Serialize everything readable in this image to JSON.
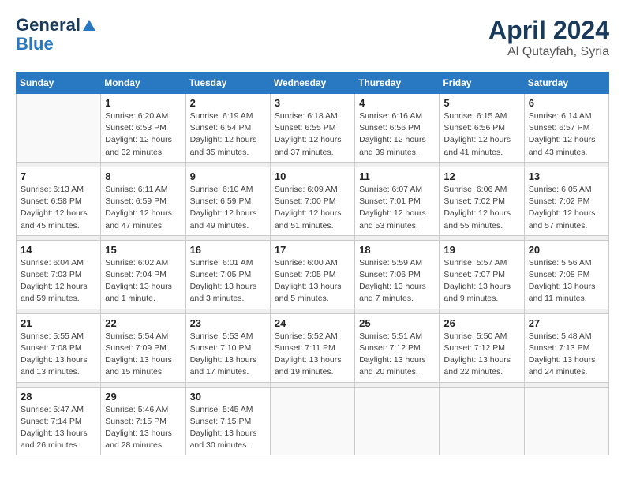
{
  "header": {
    "logo_line1": "General",
    "logo_line2": "Blue",
    "title": "April 2024",
    "location": "Al Qutayfah, Syria"
  },
  "days_of_week": [
    "Sunday",
    "Monday",
    "Tuesday",
    "Wednesday",
    "Thursday",
    "Friday",
    "Saturday"
  ],
  "weeks": [
    {
      "days": [
        {
          "num": "",
          "detail": ""
        },
        {
          "num": "1",
          "detail": "Sunrise: 6:20 AM\nSunset: 6:53 PM\nDaylight: 12 hours\nand 32 minutes."
        },
        {
          "num": "2",
          "detail": "Sunrise: 6:19 AM\nSunset: 6:54 PM\nDaylight: 12 hours\nand 35 minutes."
        },
        {
          "num": "3",
          "detail": "Sunrise: 6:18 AM\nSunset: 6:55 PM\nDaylight: 12 hours\nand 37 minutes."
        },
        {
          "num": "4",
          "detail": "Sunrise: 6:16 AM\nSunset: 6:56 PM\nDaylight: 12 hours\nand 39 minutes."
        },
        {
          "num": "5",
          "detail": "Sunrise: 6:15 AM\nSunset: 6:56 PM\nDaylight: 12 hours\nand 41 minutes."
        },
        {
          "num": "6",
          "detail": "Sunrise: 6:14 AM\nSunset: 6:57 PM\nDaylight: 12 hours\nand 43 minutes."
        }
      ]
    },
    {
      "days": [
        {
          "num": "7",
          "detail": "Sunrise: 6:13 AM\nSunset: 6:58 PM\nDaylight: 12 hours\nand 45 minutes."
        },
        {
          "num": "8",
          "detail": "Sunrise: 6:11 AM\nSunset: 6:59 PM\nDaylight: 12 hours\nand 47 minutes."
        },
        {
          "num": "9",
          "detail": "Sunrise: 6:10 AM\nSunset: 6:59 PM\nDaylight: 12 hours\nand 49 minutes."
        },
        {
          "num": "10",
          "detail": "Sunrise: 6:09 AM\nSunset: 7:00 PM\nDaylight: 12 hours\nand 51 minutes."
        },
        {
          "num": "11",
          "detail": "Sunrise: 6:07 AM\nSunset: 7:01 PM\nDaylight: 12 hours\nand 53 minutes."
        },
        {
          "num": "12",
          "detail": "Sunrise: 6:06 AM\nSunset: 7:02 PM\nDaylight: 12 hours\nand 55 minutes."
        },
        {
          "num": "13",
          "detail": "Sunrise: 6:05 AM\nSunset: 7:02 PM\nDaylight: 12 hours\nand 57 minutes."
        }
      ]
    },
    {
      "days": [
        {
          "num": "14",
          "detail": "Sunrise: 6:04 AM\nSunset: 7:03 PM\nDaylight: 12 hours\nand 59 minutes."
        },
        {
          "num": "15",
          "detail": "Sunrise: 6:02 AM\nSunset: 7:04 PM\nDaylight: 13 hours\nand 1 minute."
        },
        {
          "num": "16",
          "detail": "Sunrise: 6:01 AM\nSunset: 7:05 PM\nDaylight: 13 hours\nand 3 minutes."
        },
        {
          "num": "17",
          "detail": "Sunrise: 6:00 AM\nSunset: 7:05 PM\nDaylight: 13 hours\nand 5 minutes."
        },
        {
          "num": "18",
          "detail": "Sunrise: 5:59 AM\nSunset: 7:06 PM\nDaylight: 13 hours\nand 7 minutes."
        },
        {
          "num": "19",
          "detail": "Sunrise: 5:57 AM\nSunset: 7:07 PM\nDaylight: 13 hours\nand 9 minutes."
        },
        {
          "num": "20",
          "detail": "Sunrise: 5:56 AM\nSunset: 7:08 PM\nDaylight: 13 hours\nand 11 minutes."
        }
      ]
    },
    {
      "days": [
        {
          "num": "21",
          "detail": "Sunrise: 5:55 AM\nSunset: 7:08 PM\nDaylight: 13 hours\nand 13 minutes."
        },
        {
          "num": "22",
          "detail": "Sunrise: 5:54 AM\nSunset: 7:09 PM\nDaylight: 13 hours\nand 15 minutes."
        },
        {
          "num": "23",
          "detail": "Sunrise: 5:53 AM\nSunset: 7:10 PM\nDaylight: 13 hours\nand 17 minutes."
        },
        {
          "num": "24",
          "detail": "Sunrise: 5:52 AM\nSunset: 7:11 PM\nDaylight: 13 hours\nand 19 minutes."
        },
        {
          "num": "25",
          "detail": "Sunrise: 5:51 AM\nSunset: 7:12 PM\nDaylight: 13 hours\nand 20 minutes."
        },
        {
          "num": "26",
          "detail": "Sunrise: 5:50 AM\nSunset: 7:12 PM\nDaylight: 13 hours\nand 22 minutes."
        },
        {
          "num": "27",
          "detail": "Sunrise: 5:48 AM\nSunset: 7:13 PM\nDaylight: 13 hours\nand 24 minutes."
        }
      ]
    },
    {
      "days": [
        {
          "num": "28",
          "detail": "Sunrise: 5:47 AM\nSunset: 7:14 PM\nDaylight: 13 hours\nand 26 minutes."
        },
        {
          "num": "29",
          "detail": "Sunrise: 5:46 AM\nSunset: 7:15 PM\nDaylight: 13 hours\nand 28 minutes."
        },
        {
          "num": "30",
          "detail": "Sunrise: 5:45 AM\nSunset: 7:15 PM\nDaylight: 13 hours\nand 30 minutes."
        },
        {
          "num": "",
          "detail": ""
        },
        {
          "num": "",
          "detail": ""
        },
        {
          "num": "",
          "detail": ""
        },
        {
          "num": "",
          "detail": ""
        }
      ]
    }
  ]
}
